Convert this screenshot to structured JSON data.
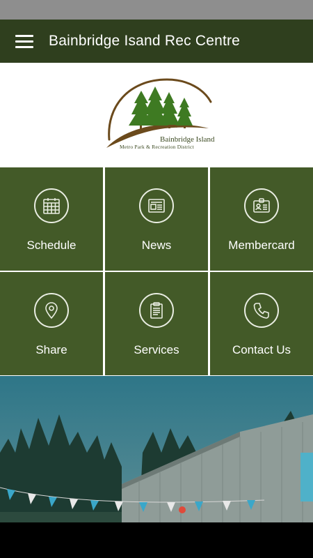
{
  "app_bar": {
    "title": "Bainbridge Isand Rec Centre"
  },
  "logo": {
    "line1": "Bainbridge Island",
    "line2": "Metro Park & Recreation District"
  },
  "tiles": [
    {
      "label": "Schedule",
      "icon": "calendar-icon"
    },
    {
      "label": "News",
      "icon": "newspaper-icon"
    },
    {
      "label": "Membercard",
      "icon": "id-card-icon"
    },
    {
      "label": "Share",
      "icon": "map-pin-icon"
    },
    {
      "label": "Services",
      "icon": "clipboard-icon"
    },
    {
      "label": "Contact Us",
      "icon": "phone-icon"
    }
  ],
  "colors": {
    "app_bar": "#2f3f1e",
    "tile": "#435a28",
    "status_bar": "#8e8e8e"
  }
}
